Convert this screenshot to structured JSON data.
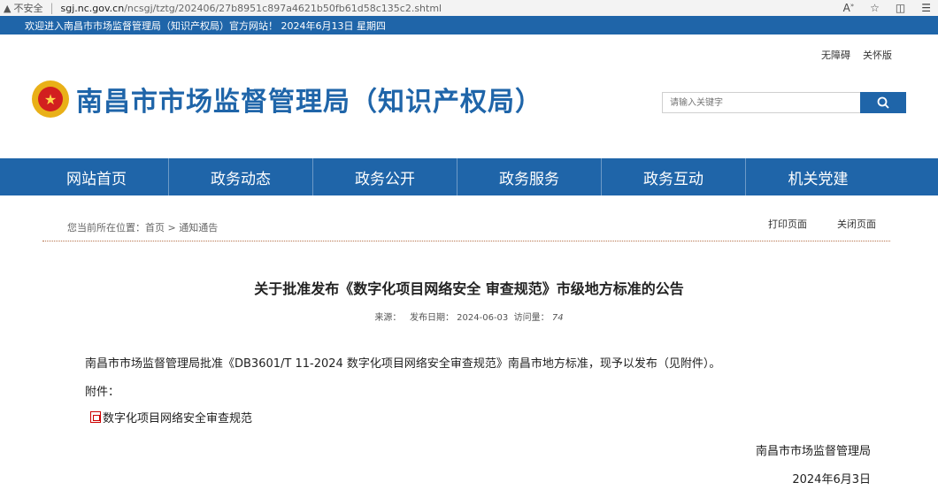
{
  "browser": {
    "insecure_label": "不安全",
    "url_domain": "sgj.nc.gov.cn",
    "url_path": "/ncsgj/tztg/202406/27b8951c897a4621b50fb61d58c135c2.shtml"
  },
  "welcome": "欢迎进入南昌市市场监督管理局（知识产权局）官方网站！ 2024年6月13日 星期四",
  "access": {
    "accessible": "无障碍",
    "care": "关怀版"
  },
  "header": {
    "title": "南昌市市场监督管理局（知识产权局）",
    "search_placeholder": "请输入关键字"
  },
  "nav": [
    "网站首页",
    "政务动态",
    "政务公开",
    "政务服务",
    "政务互动",
    "机关党建"
  ],
  "breadcrumb": "您当前所在位置：首页 > 通知通告",
  "page_tools": {
    "print": "打印页面",
    "close": "关闭页面"
  },
  "article": {
    "title": "关于批准发布《数字化项目网络安全 审查规范》市级地方标准的公告",
    "source_label": "来源：",
    "date_label": "发布日期：",
    "date": "2024-06-03",
    "views_label": "访问量：",
    "views": "74",
    "body": "南昌市市场监督管理局批准《DB3601/T 11-2024 数字化项目网络安全审查规范》南昌市地方标准，现予以发布（见附件）。",
    "attach_label": "附件：",
    "attachment": "数字化项目网络安全审查规范",
    "sign_org": "南昌市市场监督管理局",
    "sign_date": "2024年6月3日"
  },
  "colors": {
    "brand_blue": "#1f65a9"
  }
}
